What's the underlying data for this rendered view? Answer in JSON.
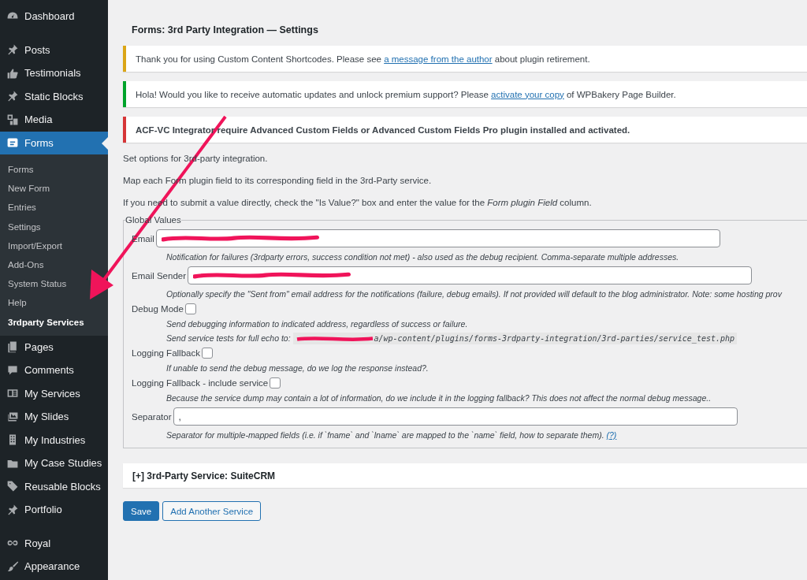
{
  "sidebar": {
    "groups": [
      [
        {
          "label": "Dashboard",
          "selected": false
        }
      ],
      [
        {
          "label": "Posts",
          "selected": false
        },
        {
          "label": "Testimonials",
          "selected": false
        },
        {
          "label": "Static Blocks",
          "selected": false
        },
        {
          "label": "Media",
          "selected": false
        },
        {
          "label": "Forms",
          "selected": true,
          "children": [
            {
              "label": "Forms",
              "selected": false
            },
            {
              "label": "New Form",
              "selected": false
            },
            {
              "label": "Entries",
              "selected": false
            },
            {
              "label": "Settings",
              "selected": false
            },
            {
              "label": "Import/Export",
              "selected": false
            },
            {
              "label": "Add-Ons",
              "selected": false
            },
            {
              "label": "System Status",
              "selected": false
            },
            {
              "label": "Help",
              "selected": false
            },
            {
              "label": "3rdparty Services",
              "selected": true
            }
          ]
        },
        {
          "label": "Pages",
          "selected": false
        },
        {
          "label": "Comments",
          "selected": false
        },
        {
          "label": "My Services",
          "selected": false
        },
        {
          "label": "My Slides",
          "selected": false
        },
        {
          "label": "My Industries",
          "selected": false
        },
        {
          "label": "My Case Studies",
          "selected": false
        },
        {
          "label": "Reusable Blocks",
          "selected": false
        },
        {
          "label": "Portfolio",
          "selected": false
        }
      ],
      [
        {
          "label": "Royal",
          "selected": false
        },
        {
          "label": "Appearance",
          "selected": false
        }
      ]
    ]
  },
  "page_title": "Forms: 3rd Party Integration — Settings",
  "notices": [
    {
      "color": "#dba617",
      "bold": false,
      "before": "Thank you for using Custom Content Shortcodes. Please see ",
      "link": "a message from the author",
      "after": " about plugin retirement."
    },
    {
      "color": "#00a32a",
      "bold": false,
      "before": "Hola! Would you like to receive automatic updates and unlock premium support? Please ",
      "link": "activate your copy",
      "after": " of WPBakery Page Builder."
    },
    {
      "color": "#d63638",
      "bold": true,
      "before": "ACF-VC Integrator require Advanced Custom Fields or Advanced Custom Fields Pro plugin installed and activated."
    }
  ],
  "intro": [
    "Set options for 3rd-party integration.",
    "Map each Form plugin field to its corresponding field in the 3rd-Party service.",
    "If you need to submit a value directly, check the \"Is Value?\" box and enter the value for the *Form plugin Field* column."
  ],
  "global_values": {
    "legend": "Global Values",
    "fields": [
      {
        "kind": "text",
        "label": "Email",
        "redacted": true,
        "descriptions": [
          {
            "text": "Notification for failures (3rdparty errors, success condition not met) - also used as the debug recipient. Comma-separate multiple addresses."
          }
        ]
      },
      {
        "kind": "text",
        "label": "Email Sender",
        "redacted": true,
        "descriptions": [
          {
            "text": "Optionally specify the \"Sent from\" email address for the notifications (failure, debug emails). If not provided will default to the blog administrator. Note: some hosting prov"
          }
        ]
      },
      {
        "kind": "checkbox",
        "label": "Debug Mode",
        "checked": false,
        "descriptions": [
          {
            "text": "Send debugging information to indicated address, regardless of success or failure."
          },
          {
            "text": "Send service tests for full echo to: ",
            "code": "a/wp-content/plugins/forms-3rdparty-integration/3rd-parties/service_test.php",
            "redacted": true
          }
        ]
      },
      {
        "kind": "checkbox",
        "label": "Logging Fallback",
        "checked": false,
        "descriptions": [
          {
            "text": "If unable to send the debug message, do we log the response instead?."
          }
        ]
      },
      {
        "kind": "checkbox",
        "label": "Logging Fallback - include service",
        "checked": false,
        "descriptions": [
          {
            "text": "Because the service dump may contain a lot of information, do we include it in the logging fallback? This does not affect the normal debug message.."
          }
        ]
      },
      {
        "kind": "text",
        "label": "Separator",
        "value": ",",
        "redacted": false,
        "descriptions": [
          {
            "text": "Separator for multiple-mapped fields (i.e. if `fname` and `lname` are mapped to the `name` field, how to separate them). ",
            "link": "(?)"
          }
        ]
      }
    ]
  },
  "service_panel": {
    "title": "[+] 3rd-Party Service: SuiteCRM",
    "expanded": false
  },
  "buttons": [
    {
      "label": "Save",
      "kind": "primary"
    },
    {
      "label": "Add Another Service",
      "kind": "secondary"
    }
  ]
}
